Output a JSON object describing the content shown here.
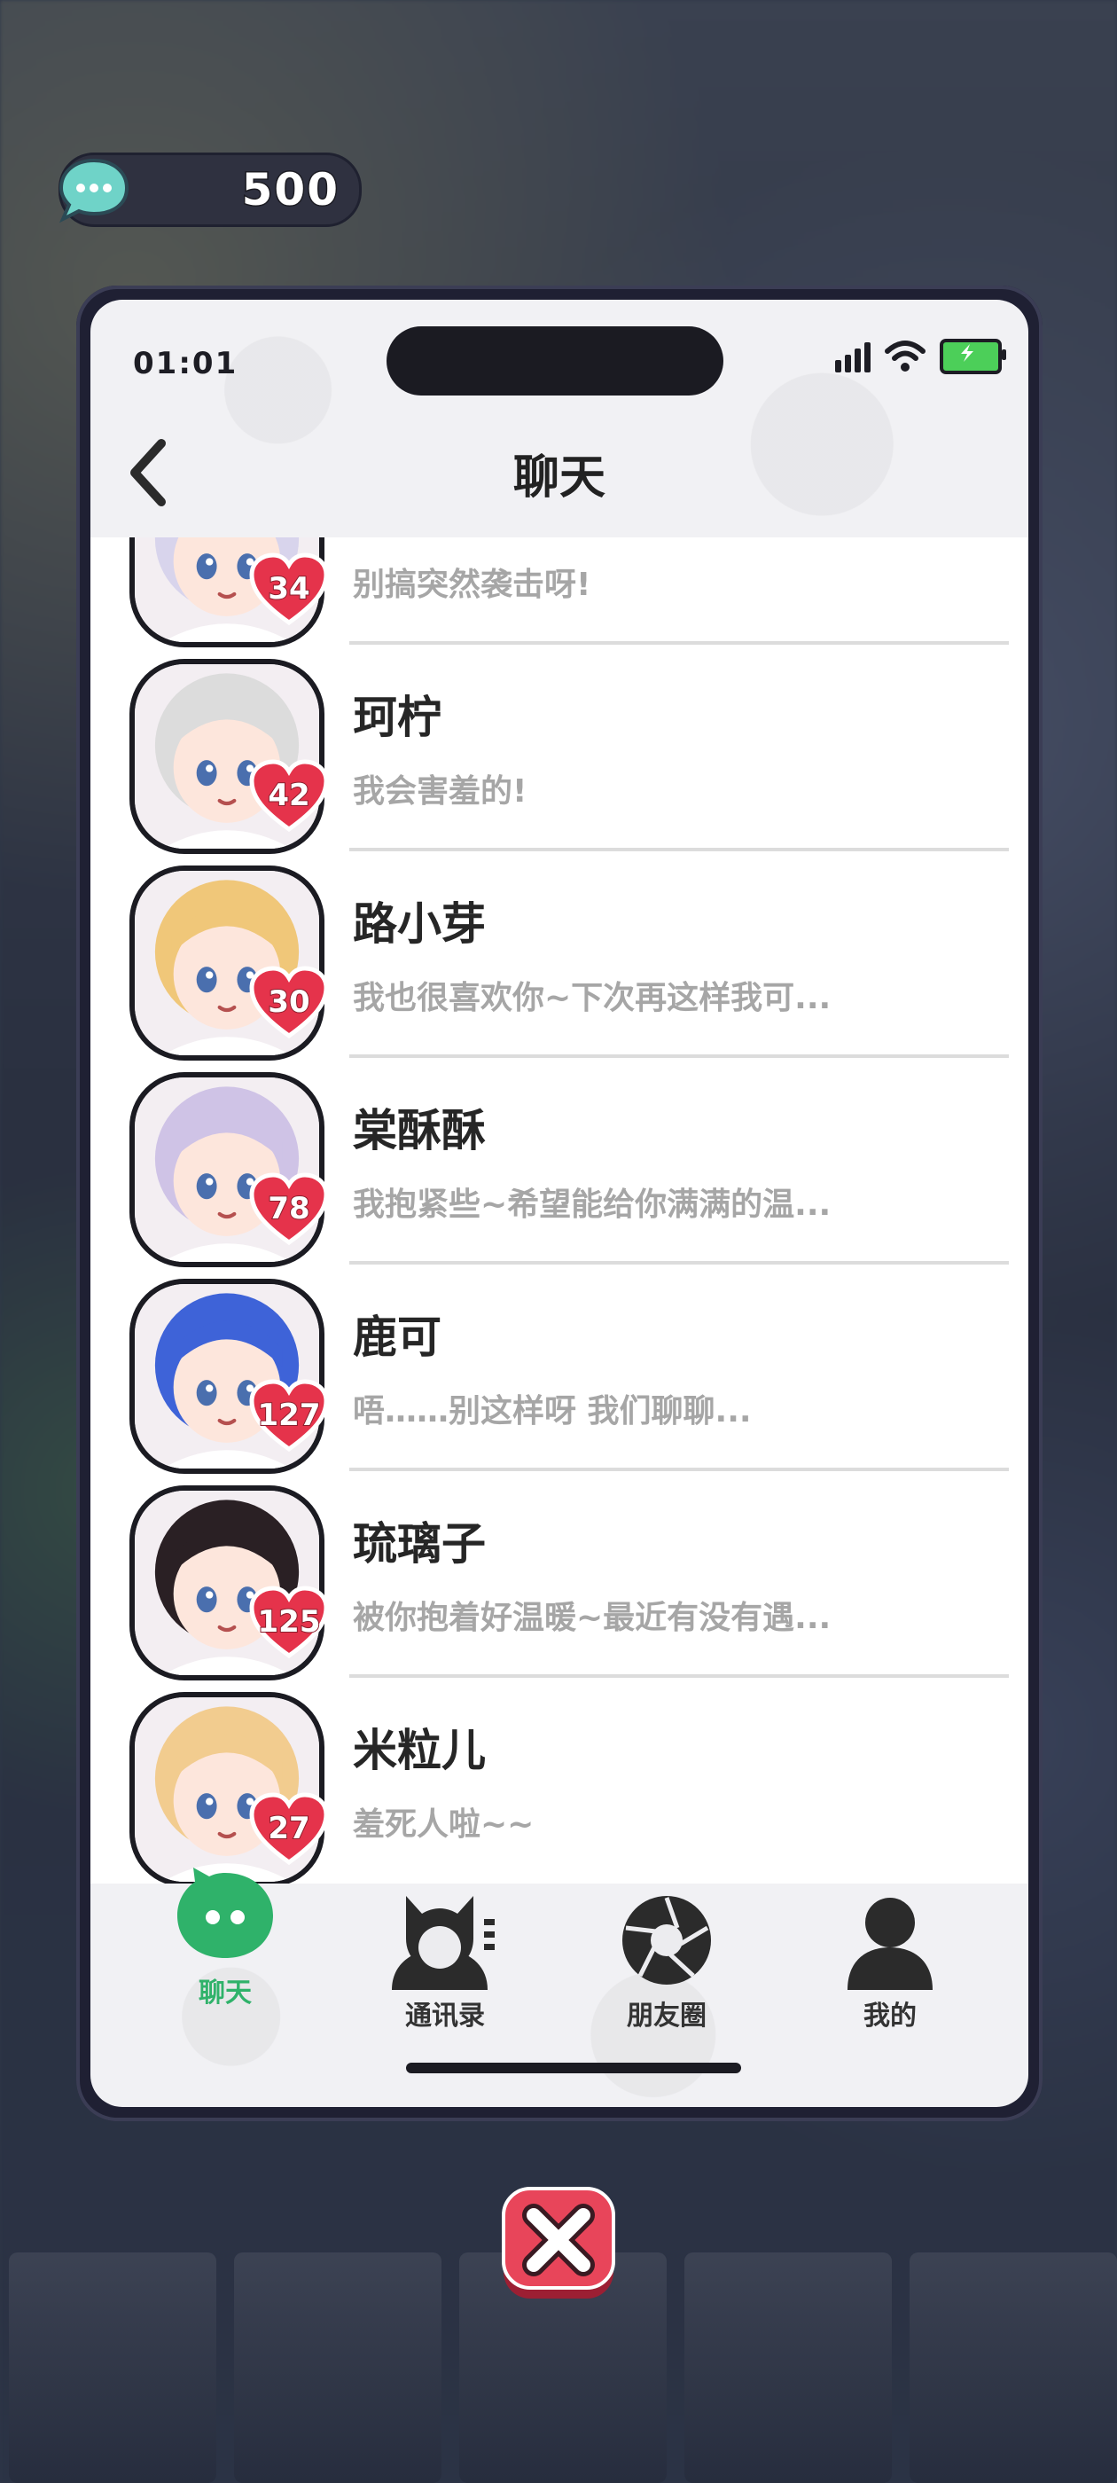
{
  "currency": {
    "value": "500",
    "icon": "chat-bubble-coin-icon"
  },
  "status_bar": {
    "time": "01:01"
  },
  "header": {
    "title": "聊天"
  },
  "chats": [
    {
      "name": "",
      "preview": "别搞突然袭击呀!",
      "affection": "34",
      "hair": "#d8d4ec"
    },
    {
      "name": "珂柠",
      "preview": "我会害羞的!",
      "affection": "42",
      "hair": "#dcdcdc"
    },
    {
      "name": "路小芽",
      "preview": "我也很喜欢你~下次再这样我可...",
      "affection": "30",
      "hair": "#f0c779"
    },
    {
      "name": "棠酥酥",
      "preview": "我抱紧些~希望能给你满满的温...",
      "affection": "78",
      "hair": "#cfc3e6"
    },
    {
      "name": "鹿可",
      "preview": "唔……别这样呀 我们聊聊...",
      "affection": "127",
      "hair": "#3e63d8"
    },
    {
      "name": "琉璃子",
      "preview": "被你抱着好温暖~最近有没有遇...",
      "affection": "125",
      "hair": "#2a2024"
    },
    {
      "name": "米粒儿",
      "preview": "羞死人啦~~",
      "affection": "27",
      "hair": "#f2cc8f"
    }
  ],
  "tabs": [
    {
      "label": "聊天",
      "icon": "chat-icon",
      "active": true
    },
    {
      "label": "通讯录",
      "icon": "contacts-icon",
      "active": false
    },
    {
      "label": "朋友圈",
      "icon": "moments-aperture-icon",
      "active": false
    },
    {
      "label": "我的",
      "icon": "profile-icon",
      "active": false
    }
  ],
  "colors": {
    "accent_green": "#2fb26a",
    "heart_red": "#e5334b",
    "close_red": "#e8455a"
  }
}
